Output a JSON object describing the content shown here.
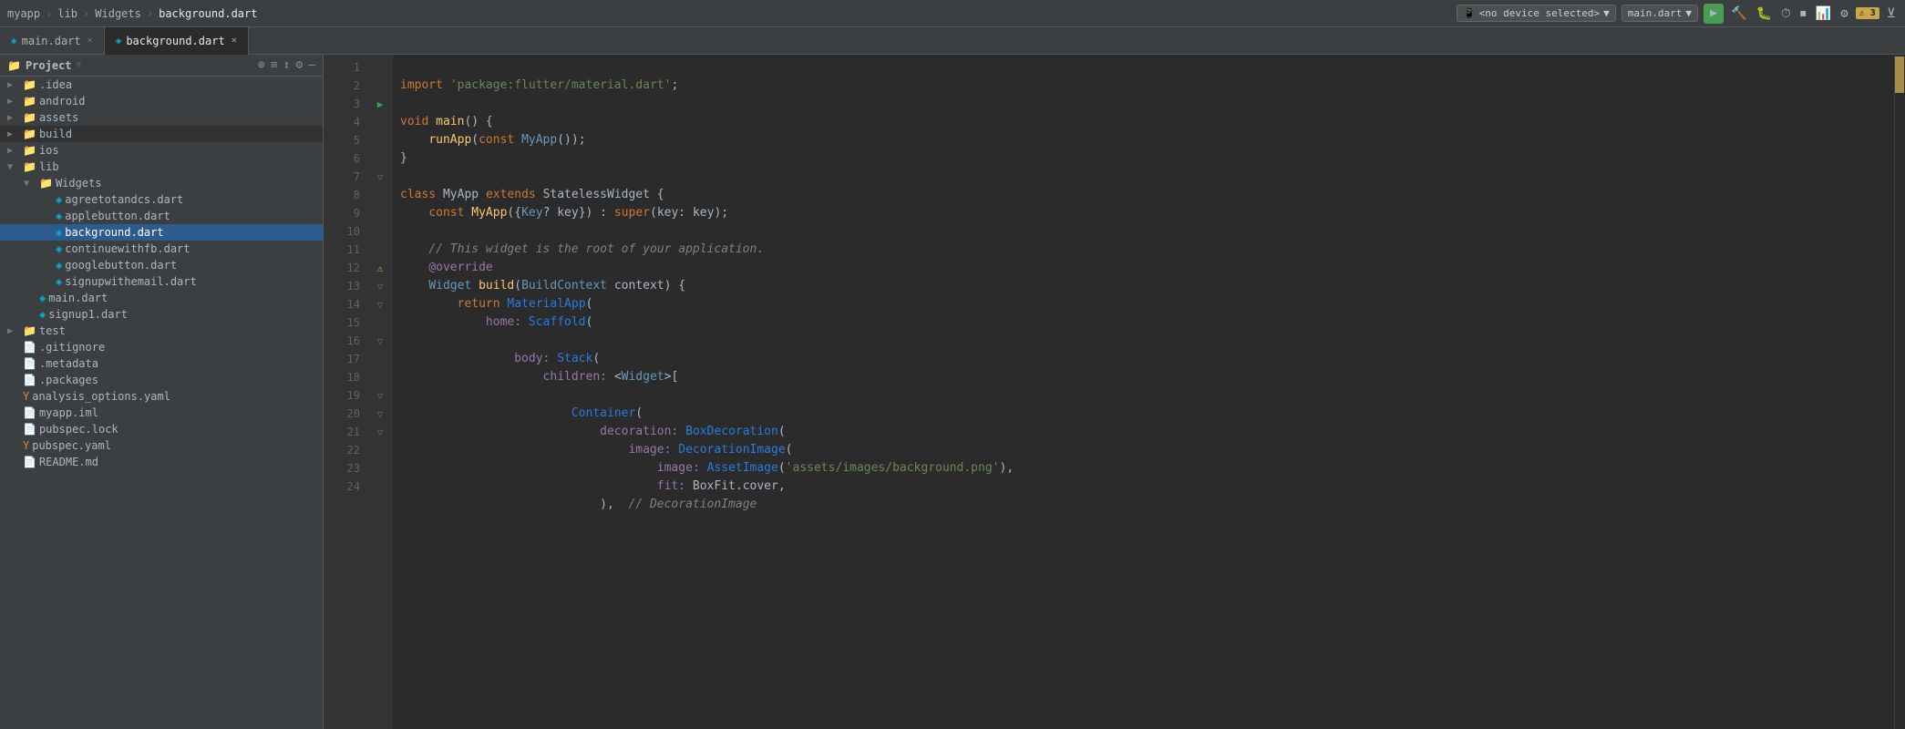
{
  "topbar": {
    "breadcrumb": [
      "myapp",
      "lib",
      "Widgets",
      "background.dart"
    ],
    "device_selector": "<no device selected>",
    "run_file": "main.dart",
    "warning_count": "3"
  },
  "tabs": [
    {
      "label": "main.dart",
      "icon": "dart",
      "active": false
    },
    {
      "label": "background.dart",
      "icon": "dart",
      "active": true
    }
  ],
  "sidebar": {
    "title": "Project",
    "items": [
      {
        "id": "idea",
        "label": ".idea",
        "type": "folder",
        "indent": 8,
        "expanded": false,
        "arrow": "▶"
      },
      {
        "id": "android",
        "label": "android",
        "type": "folder",
        "indent": 8,
        "expanded": false,
        "arrow": "▶"
      },
      {
        "id": "assets",
        "label": "assets",
        "type": "folder",
        "indent": 8,
        "expanded": false,
        "arrow": "▶"
      },
      {
        "id": "build",
        "label": "build",
        "type": "folder-yellow",
        "indent": 8,
        "expanded": false,
        "arrow": "▶"
      },
      {
        "id": "ios",
        "label": "ios",
        "type": "folder",
        "indent": 8,
        "expanded": false,
        "arrow": "▶"
      },
      {
        "id": "lib",
        "label": "lib",
        "type": "folder",
        "indent": 8,
        "expanded": true,
        "arrow": "▼"
      },
      {
        "id": "widgets",
        "label": "Widgets",
        "type": "folder",
        "indent": 26,
        "expanded": true,
        "arrow": "▼"
      },
      {
        "id": "agreetotandcs",
        "label": "agreetotandcs.dart",
        "type": "dart",
        "indent": 44,
        "arrow": ""
      },
      {
        "id": "applebutton",
        "label": "applebutton.dart",
        "type": "dart",
        "indent": 44,
        "arrow": ""
      },
      {
        "id": "background",
        "label": "background.dart",
        "type": "dart",
        "indent": 44,
        "arrow": "",
        "selected": true
      },
      {
        "id": "continuewithfb",
        "label": "continuewithfb.dart",
        "type": "dart",
        "indent": 44,
        "arrow": ""
      },
      {
        "id": "googlebutton",
        "label": "googlebutton.dart",
        "type": "dart",
        "indent": 44,
        "arrow": ""
      },
      {
        "id": "signupwithemail",
        "label": "signupwithemail.dart",
        "type": "dart",
        "indent": 44,
        "arrow": ""
      },
      {
        "id": "main",
        "label": "main.dart",
        "type": "dart",
        "indent": 26,
        "arrow": ""
      },
      {
        "id": "signup1",
        "label": "signup1.dart",
        "type": "dart",
        "indent": 26,
        "arrow": ""
      },
      {
        "id": "test",
        "label": "test",
        "type": "folder",
        "indent": 8,
        "expanded": false,
        "arrow": "▶"
      },
      {
        "id": "gitignore",
        "label": ".gitignore",
        "type": "other",
        "indent": 8,
        "arrow": ""
      },
      {
        "id": "metadata",
        "label": ".metadata",
        "type": "other",
        "indent": 8,
        "arrow": ""
      },
      {
        "id": "packages",
        "label": ".packages",
        "type": "other",
        "indent": 8,
        "arrow": ""
      },
      {
        "id": "analysis_options",
        "label": "analysis_options.yaml",
        "type": "yaml",
        "indent": 8,
        "arrow": ""
      },
      {
        "id": "myapp_iml",
        "label": "myapp.iml",
        "type": "other",
        "indent": 8,
        "arrow": ""
      },
      {
        "id": "pubspec_lock",
        "label": "pubspec.lock",
        "type": "other",
        "indent": 8,
        "arrow": ""
      },
      {
        "id": "pubspec_yaml",
        "label": "pubspec.yaml",
        "type": "yaml",
        "indent": 8,
        "arrow": ""
      },
      {
        "id": "readme",
        "label": "README.md",
        "type": "other",
        "indent": 8,
        "arrow": ""
      }
    ]
  },
  "code": {
    "lines": [
      {
        "n": 1,
        "content": "import 'package:flutter/material.dart';"
      },
      {
        "n": 2,
        "content": ""
      },
      {
        "n": 3,
        "content": "void main() {",
        "gutter": "run"
      },
      {
        "n": 4,
        "content": "    runApp(const MyApp());"
      },
      {
        "n": 5,
        "content": "}"
      },
      {
        "n": 6,
        "content": ""
      },
      {
        "n": 7,
        "content": "class MyApp extends StatelessWidget {"
      },
      {
        "n": 8,
        "content": "    const MyApp({Key? key}) : super(key: key);"
      },
      {
        "n": 9,
        "content": ""
      },
      {
        "n": 10,
        "content": "    // This widget is the root of your application."
      },
      {
        "n": 11,
        "content": "    @override"
      },
      {
        "n": 12,
        "content": "    Widget build(BuildContext context) {",
        "gutter": "warning"
      },
      {
        "n": 13,
        "content": "        return MaterialApp("
      },
      {
        "n": 14,
        "content": "            home: Scaffold("
      },
      {
        "n": 15,
        "content": ""
      },
      {
        "n": 16,
        "content": "                body: Stack("
      },
      {
        "n": 17,
        "content": "                    children: <Widget>["
      },
      {
        "n": 18,
        "content": ""
      },
      {
        "n": 19,
        "content": "                        Container("
      },
      {
        "n": 20,
        "content": "                            decoration: BoxDecoration("
      },
      {
        "n": 21,
        "content": "                                image: DecorationImage("
      },
      {
        "n": 22,
        "content": "                                    image: AssetImage('assets/images/background.png'),"
      },
      {
        "n": 23,
        "content": "                                    fit: BoxFit.cover,"
      },
      {
        "n": 24,
        "content": "                            ),  // DecorationImage"
      }
    ]
  }
}
